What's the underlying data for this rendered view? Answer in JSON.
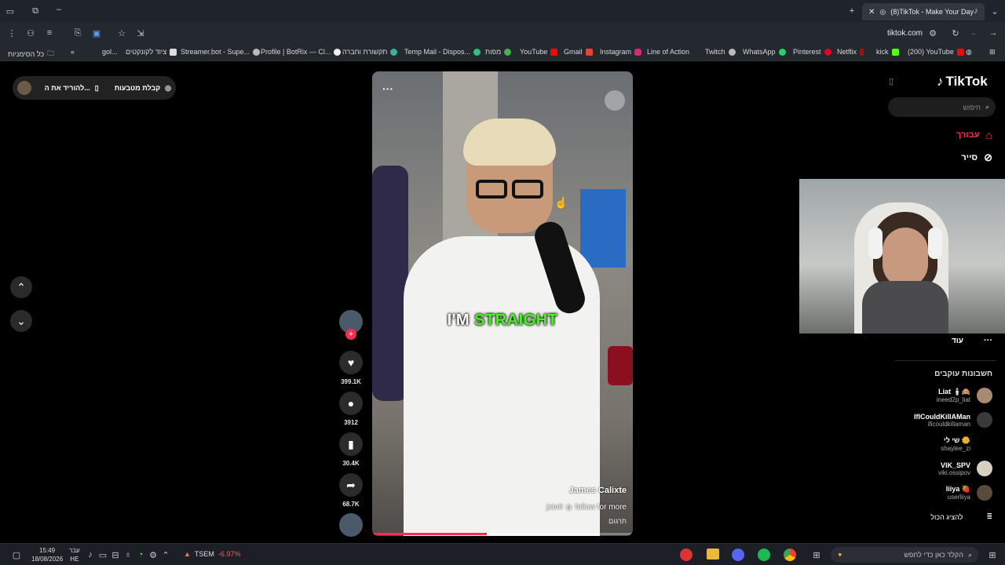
{
  "browser": {
    "active_tab_title": "(8)TikTok - Make Your Day",
    "url": "tiktok.com",
    "bookmarks": [
      "כל הסימניות",
      "gol...",
      "ציוד לקונקטים",
      "Streamer.bot - Supe...",
      "Profile | BotRix — Cl...",
      "תקשורת וחברה",
      "Temp Mail - Dispos...",
      "מפות",
      "YouTube",
      "Gmail",
      "Instagram",
      "Line of Action",
      "Twitch",
      "WhatsApp",
      "Pinterest",
      "Netflix",
      "kick",
      "(200) YouTube"
    ]
  },
  "tiktok": {
    "logo": "TikTok",
    "search_placeholder": "חיפוש",
    "nav": [
      {
        "label": "עבורך",
        "icon": "home-icon",
        "active": true
      },
      {
        "label": "סייר",
        "icon": "compass-icon",
        "active": false
      }
    ],
    "more_label": "עוד",
    "following_header": "חשבונות עוקבים",
    "following": [
      {
        "name": "Liat 🕯️🙈",
        "handle": "ineed2p_liat"
      },
      {
        "name": "IfICouldKillAMan",
        "handle": "ificouldkillaman"
      },
      {
        "name": "שי לי 🌼",
        "handle": "shaylee_zi"
      },
      {
        "name": "VIK_SPV",
        "handle": "viki.ossipov"
      },
      {
        "name": "liiya 🍓",
        "handle": "userliiya"
      }
    ],
    "show_all": "להציג הכול",
    "download_pill": {
      "get_coins": "קבלת מטבעות",
      "download_app": "להוריד את ה..."
    },
    "video": {
      "caption_overlay_white": "I'M",
      "caption_overlay_green": "STRAIGHT",
      "author": "James Calixte",
      "description": "follow for more",
      "hashtag": "jctv#",
      "translate": "תרגום",
      "progress": 0.44
    },
    "stats": {
      "likes": "399.1K",
      "comments": "3912",
      "saves": "30.4K",
      "shares": "68.7K"
    }
  },
  "taskbar": {
    "time": "15:49",
    "date": "18/08/2026",
    "lang1": "עבר",
    "lang2": "HE",
    "ticker": "TSEM",
    "ticker_change": "-6.97%",
    "search_placeholder": "הקלד כאן כדי לחפש"
  },
  "colors": {
    "tiktok_red": "#fe2c55",
    "caption_green": "#4cf02a",
    "ticker_red": "#ff5a5a"
  }
}
